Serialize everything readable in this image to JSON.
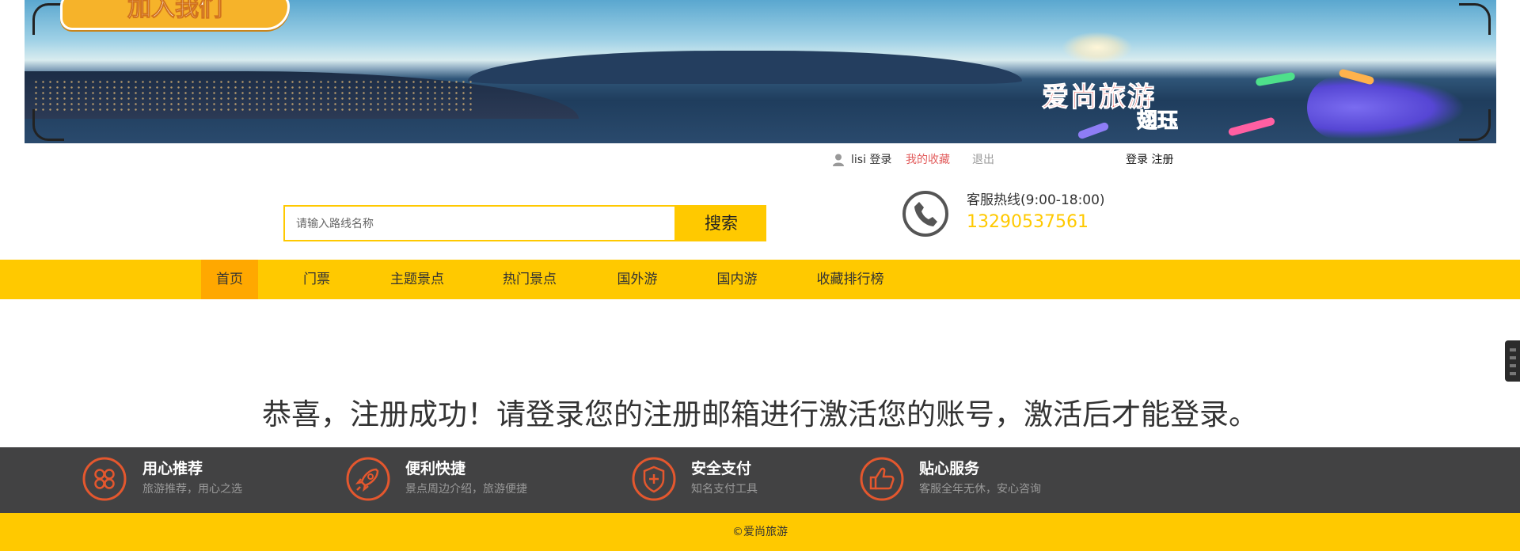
{
  "banner": {
    "join_text": "加入我们",
    "brand_text": "爱尚旅游",
    "brand_sub": "翅珏"
  },
  "login_bar": {
    "user_text": "lisi 登录",
    "favorites": "我的收藏",
    "logout": "退出",
    "auth_links": "登录 注册",
    "favorites_color": "#e25d5d"
  },
  "search": {
    "placeholder": "请输入路线名称",
    "button_label": "搜索"
  },
  "hotline": {
    "label": "客服热线(9:00-18:00)",
    "number": "13290537561",
    "number_color": "#ffc900"
  },
  "nav": {
    "items": [
      {
        "label": "首页",
        "active": true
      },
      {
        "label": "门票"
      },
      {
        "label": "主题景点"
      },
      {
        "label": "热门景点"
      },
      {
        "label": "国外游"
      },
      {
        "label": "国内游"
      },
      {
        "label": "收藏排行榜"
      }
    ]
  },
  "main": {
    "message": "恭喜，注册成功！请登录您的注册邮箱进行激活您的账号，激活后才能登录。"
  },
  "features": [
    {
      "icon": "clover-icon",
      "title": "用心推荐",
      "subtitle": "旅游推荐，用心之选"
    },
    {
      "icon": "rocket-icon",
      "title": "便利快捷",
      "subtitle": "景点周边介绍，旅游便捷"
    },
    {
      "icon": "shield-icon",
      "title": "安全支付",
      "subtitle": "知名支付工具"
    },
    {
      "icon": "thumbs-up-icon",
      "title": "贴心服务",
      "subtitle": "客服全年无休，安心咨询"
    }
  ],
  "footer": {
    "copyright": "©爱尚旅游"
  },
  "colors": {
    "accent": "#ffc900",
    "nav_active": "#ffa800",
    "feature_bg": "#424243",
    "icon_orange": "#e4572e"
  }
}
